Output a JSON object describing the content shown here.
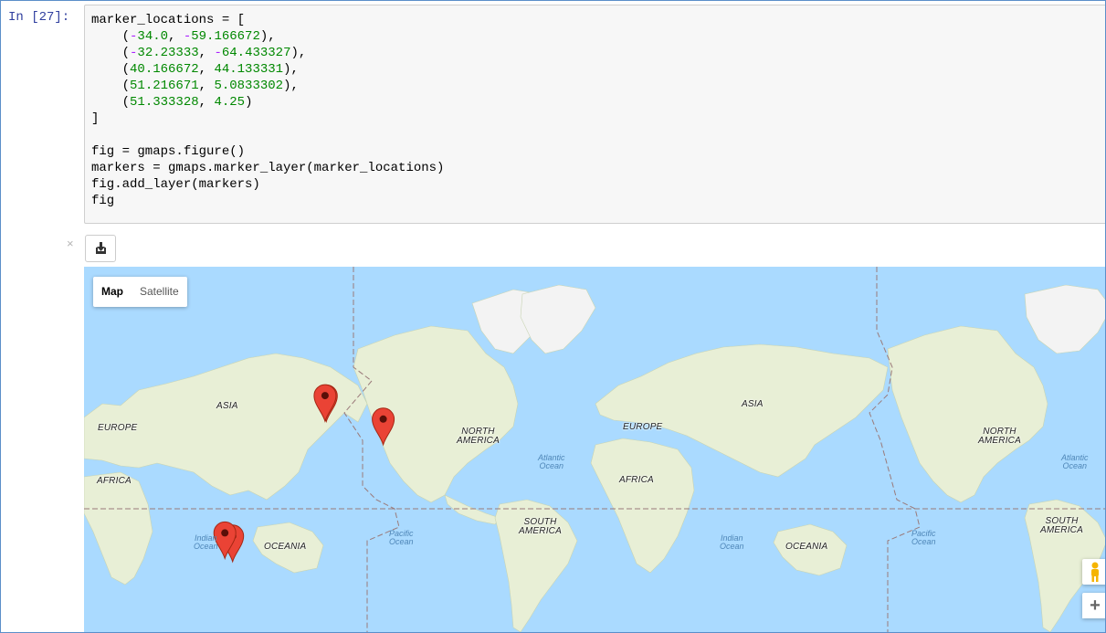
{
  "cell": {
    "prompt": "In [27]:",
    "code_lines": [
      "marker_locations = [",
      "    (-34.0, -59.166672),",
      "    (-32.23333, -64.433327),",
      "    (40.166672, 44.133331),",
      "    (51.216671, 5.0833302),",
      "    (51.333328, 4.25)",
      "]",
      "",
      "fig = gmaps.figure()",
      "markers = gmaps.marker_layer(marker_locations)",
      "fig.add_layer(markers)",
      "fig"
    ]
  },
  "output": {
    "close_symbol": "×",
    "download_icon": "download-icon"
  },
  "map": {
    "type_control": {
      "map_label": "Map",
      "satellite_label": "Satellite",
      "selected": "Map"
    },
    "marker_color": "#ea4335",
    "water_color": "#aadaff",
    "land_color": "#e8efd6",
    "markers": [
      {
        "lat": -34.0,
        "lng": -59.166672
      },
      {
        "lat": -32.23333,
        "lng": -64.433327
      },
      {
        "lat": 40.166672,
        "lng": 44.133331
      },
      {
        "lat": 51.216671,
        "lng": 5.0833302
      },
      {
        "lat": 51.333328,
        "lng": 4.25
      }
    ],
    "continent_labels": {
      "europe_left": "EUROPE",
      "asia_left": "ASIA",
      "africa_left": "AFRICA",
      "oceania_left": "OCEANIA",
      "north_america_1": "NORTH",
      "north_america_2": "AMERICA",
      "south_america_1": "SOUTH",
      "south_america_2": "AMERICA",
      "europe": "EUROPE",
      "asia": "ASIA",
      "africa": "AFRICA",
      "oceania": "OCEANIA",
      "north_america_right_1": "NORTH",
      "north_america_right_2": "AMERICA",
      "south_america_right_1": "SOUTH",
      "south_america_right_2": "AMERICA"
    },
    "ocean_labels": {
      "indian_1a": "Indian",
      "indian_1b": "Ocean",
      "pacific_1a": "Pacific",
      "pacific_1b": "Ocean",
      "atlantic_1a": "Atlantic",
      "atlantic_1b": "Ocean",
      "indian_2a": "Indian",
      "indian_2b": "Ocean",
      "pacific_2a": "Pacific",
      "pacific_2b": "Ocean",
      "atlantic_2a": "Atlantic",
      "atlantic_2b": "Ocean"
    },
    "controls": {
      "pegman_icon": "pegman-icon",
      "zoom_in_label": "+"
    }
  }
}
